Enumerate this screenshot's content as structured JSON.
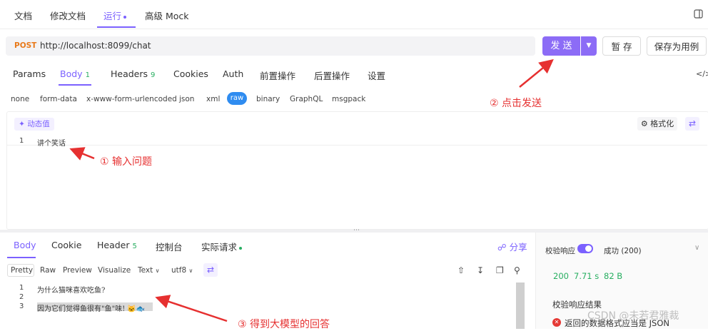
{
  "top_tabs": [
    "文档",
    "修改文档",
    "运行",
    "高级 Mock"
  ],
  "request": {
    "method": "POST",
    "url": "http://localhost:8099/chat",
    "send_label": "发 送",
    "save_label": "暂 存",
    "save_case_label": "保存为用例"
  },
  "req_tabs": {
    "params": "Params",
    "body": "Body",
    "body_count": "1",
    "headers": "Headers",
    "headers_count": "9",
    "cookies": "Cookies",
    "auth": "Auth",
    "pre": "前置操作",
    "post": "后置操作",
    "settings": "设置"
  },
  "body_types": [
    "none",
    "form-data",
    "x-www-form-urlencoded",
    "json",
    "xml",
    "raw",
    "binary",
    "GraphQL",
    "msgpack"
  ],
  "editor": {
    "dynamic_label": "动态值",
    "format_label": "格式化",
    "line1_num": "1",
    "line1_text": "讲个笑话"
  },
  "annotations": {
    "a1": "① 输入问题",
    "a2": "② 点击发送",
    "a3": "③ 得到大模型的回答"
  },
  "resp_tabs": {
    "body": "Body",
    "cookie": "Cookie",
    "header": "Header",
    "header_count": "5",
    "console": "控制台",
    "actual": "实际请求",
    "share": "分享"
  },
  "resp_formats": [
    "Pretty",
    "Raw",
    "Preview",
    "Visualize",
    "Text",
    "utf8"
  ],
  "response_lines": [
    {
      "num": "1",
      "text": "为什么猫咪喜欢吃鱼?"
    },
    {
      "num": "2",
      "text": ""
    },
    {
      "num": "3",
      "text": "因为它们觉得鱼很有\"鱼\"味! 🐱🐟"
    }
  ],
  "right_panel": {
    "validate_label": "校验响应",
    "success": "成功 (200)",
    "status": "200",
    "time": "7.71 s",
    "size": "82 B",
    "result_title": "校验响应结果",
    "error_text": "返回的数据格式应当是 JSON",
    "watermark": "CSDN @未若君雅裁"
  },
  "colors": {
    "accent": "#7b61ff",
    "send": "#8c6cf6",
    "post": "#e8791a",
    "annotation": "#e63030",
    "ok": "#27ae60"
  }
}
